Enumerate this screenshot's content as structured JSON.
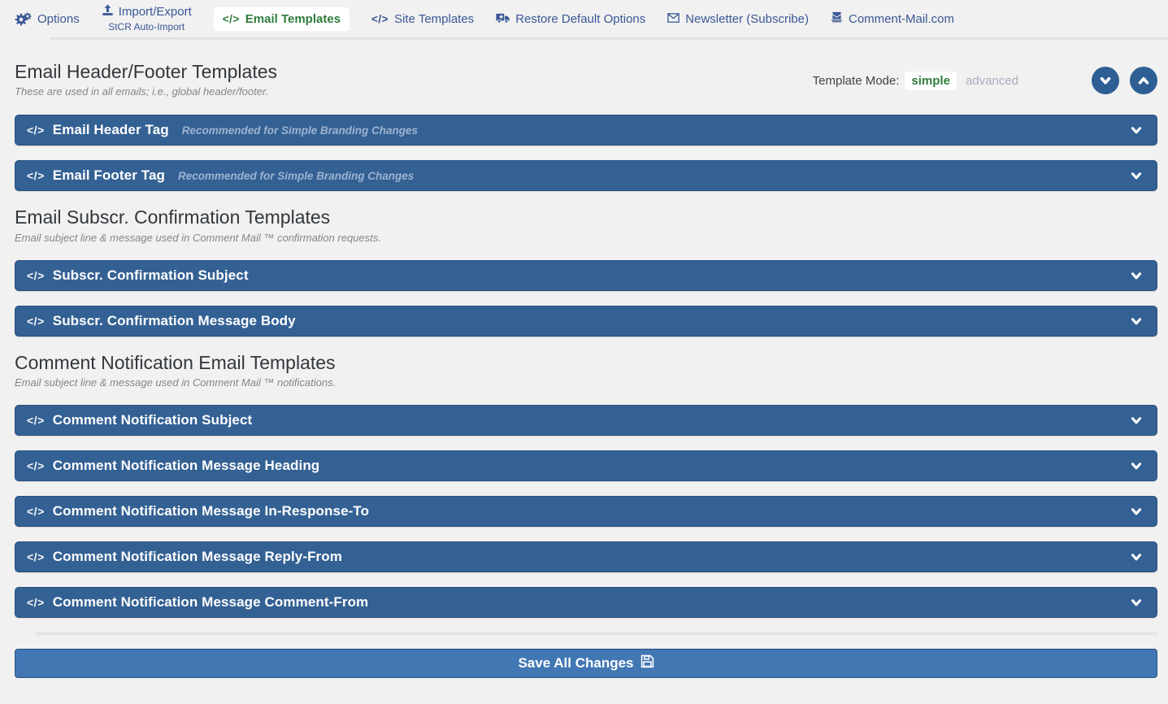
{
  "colors": {
    "page_bg": "#f1f1f1",
    "nav_link_blue": "#3a5795",
    "active_tab_green": "#2f7d3c",
    "panel_bg": "#346194",
    "panel_note_text": "#9db3cf",
    "circle_button_bg": "#2e5f94",
    "save_button_bg": "#4277b4"
  },
  "icons": {
    "code": "</>"
  },
  "nav": {
    "options": "Options",
    "import_export": "Import/Export",
    "stcr_auto_import": "StCR Auto-Import",
    "email_templates": "Email Templates",
    "site_templates": "Site Templates",
    "restore_default_options": "Restore Default Options",
    "newsletter": "Newsletter (Subscribe)",
    "comment_mail_com": "Comment-Mail.com"
  },
  "header": {
    "title": "Email Header/Footer Templates",
    "subtitle": "These are used in all emails; i.e., global header/footer.",
    "template_mode_label": "Template Mode:",
    "mode_simple": "simple",
    "mode_advanced": "advanced"
  },
  "sections": {
    "subscr_confirmation": {
      "heading": "Email Subscr. Confirmation Templates",
      "subheading": "Email subject line & message used in Comment Mail ™ confirmation requests."
    },
    "comment_notification": {
      "heading": "Comment Notification Email Templates",
      "subheading": "Email subject line & message used in Comment Mail ™ notifications."
    }
  },
  "panels": [
    {
      "title": "Email Header Tag",
      "note": "Recommended for Simple Branding Changes"
    },
    {
      "title": "Email Footer Tag",
      "note": "Recommended for Simple Branding Changes"
    },
    {
      "title": "Subscr. Confirmation Subject",
      "note": ""
    },
    {
      "title": "Subscr. Confirmation Message Body",
      "note": ""
    },
    {
      "title": "Comment Notification Subject",
      "note": ""
    },
    {
      "title": "Comment Notification Message Heading",
      "note": ""
    },
    {
      "title": "Comment Notification Message In-Response-To",
      "note": ""
    },
    {
      "title": "Comment Notification Message Reply-From",
      "note": ""
    },
    {
      "title": "Comment Notification Message Comment-From",
      "note": ""
    }
  ],
  "footer": {
    "save_label": "Save All Changes"
  }
}
